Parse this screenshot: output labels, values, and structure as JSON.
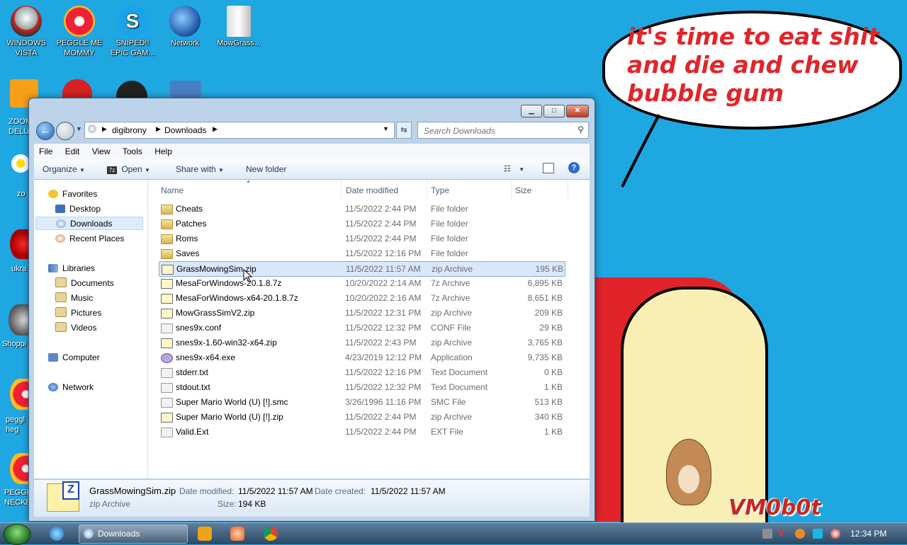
{
  "desktop": {
    "icons": [
      {
        "label": "WINDOWS VISTA",
        "icon": "helmet-icon"
      },
      {
        "label": "PEGGLE ME MOMMY",
        "icon": "peggle-icon"
      },
      {
        "label": "SNIPED!! EPIC GAM...",
        "icon": "skype-icon"
      },
      {
        "label": "Network",
        "icon": "network-globe-icon"
      },
      {
        "label": "MowGrass...",
        "icon": "document-icon"
      }
    ],
    "partial_icons": [
      {
        "label": "ZOOM DELU"
      },
      {
        "label": "zo"
      },
      {
        "label": "ukra"
      },
      {
        "label": "Shoppi"
      },
      {
        "label": "peggl heg"
      },
      {
        "label": "PEGGL NECKE"
      }
    ],
    "bubble_text": "it's time to eat shit and die and chew bubble gum",
    "watermark": "VM0b0t"
  },
  "window": {
    "breadcrumb": [
      "digibrony",
      "Downloads"
    ],
    "search_placeholder": "Search Downloads",
    "menu": [
      "File",
      "Edit",
      "View",
      "Tools",
      "Help"
    ],
    "toolbar": {
      "organize": "Organize",
      "open": "Open",
      "share": "Share with",
      "new_folder": "New folder"
    },
    "nav": {
      "favorites": "Favorites",
      "desktop": "Desktop",
      "downloads": "Downloads",
      "recent": "Recent Places",
      "libraries": "Libraries",
      "documents": "Documents",
      "music": "Music",
      "pictures": "Pictures",
      "videos": "Videos",
      "computer": "Computer",
      "network": "Network"
    },
    "columns": {
      "name": "Name",
      "date": "Date modified",
      "type": "Type",
      "size": "Size"
    },
    "files": [
      {
        "name": "Cheats",
        "date": "11/5/2022 2:44 PM",
        "type": "File folder",
        "size": "",
        "icon": "folder"
      },
      {
        "name": "Patches",
        "date": "11/5/2022 2:44 PM",
        "type": "File folder",
        "size": "",
        "icon": "folder"
      },
      {
        "name": "Roms",
        "date": "11/5/2022 2:44 PM",
        "type": "File folder",
        "size": "",
        "icon": "folder"
      },
      {
        "name": "Saves",
        "date": "11/5/2022 12:16 PM",
        "type": "File folder",
        "size": "",
        "icon": "folder"
      },
      {
        "name": "GrassMowingSim.zip",
        "date": "11/5/2022 11:57 AM",
        "type": "zip Archive",
        "size": "195 KB",
        "icon": "zip",
        "selected": true
      },
      {
        "name": "MesaForWindows-20.1.8.7z",
        "date": "10/20/2022 2:14 AM",
        "type": "7z Archive",
        "size": "6,895 KB",
        "icon": "zip"
      },
      {
        "name": "MesaForWindows-x64-20.1.8.7z",
        "date": "10/20/2022 2:16 AM",
        "type": "7z Archive",
        "size": "8,651 KB",
        "icon": "zip"
      },
      {
        "name": "MowGrassSimV2.zip",
        "date": "11/5/2022 12:31 PM",
        "type": "zip Archive",
        "size": "209 KB",
        "icon": "zip"
      },
      {
        "name": "snes9x.conf",
        "date": "11/5/2022 12:32 PM",
        "type": "CONF File",
        "size": "29 KB",
        "icon": "doc"
      },
      {
        "name": "snes9x-1.60-win32-x64.zip",
        "date": "11/5/2022 2:43 PM",
        "type": "zip Archive",
        "size": "3,765 KB",
        "icon": "zip"
      },
      {
        "name": "snes9x-x64.exe",
        "date": "4/23/2019 12:12 PM",
        "type": "Application",
        "size": "9,735 KB",
        "icon": "exe"
      },
      {
        "name": "stderr.txt",
        "date": "11/5/2022 12:16 PM",
        "type": "Text Document",
        "size": "0 KB",
        "icon": "doc"
      },
      {
        "name": "stdout.txt",
        "date": "11/5/2022 12:32 PM",
        "type": "Text Document",
        "size": "1 KB",
        "icon": "doc"
      },
      {
        "name": "Super Mario World (U) [!].smc",
        "date": "3/26/1996 11:16 PM",
        "type": "SMC File",
        "size": "513 KB",
        "icon": "doc"
      },
      {
        "name": "Super Mario World (U) [!].zip",
        "date": "11/5/2022 2:44 PM",
        "type": "zip Archive",
        "size": "340 KB",
        "icon": "zip"
      },
      {
        "name": "Valid.Ext",
        "date": "11/5/2022 2:44 PM",
        "type": "EXT File",
        "size": "1 KB",
        "icon": "doc"
      }
    ],
    "details": {
      "name": "GrassMowingSim.zip",
      "type": "zip Archive",
      "modified_label": "Date modified:",
      "modified": "11/5/2022 11:57 AM",
      "created_label": "Date created:",
      "created": "11/5/2022 11:57 AM",
      "size_label": "Size:",
      "size": "194 KB"
    }
  },
  "taskbar": {
    "task_label": "Downloads",
    "clock": "12:34 PM"
  }
}
